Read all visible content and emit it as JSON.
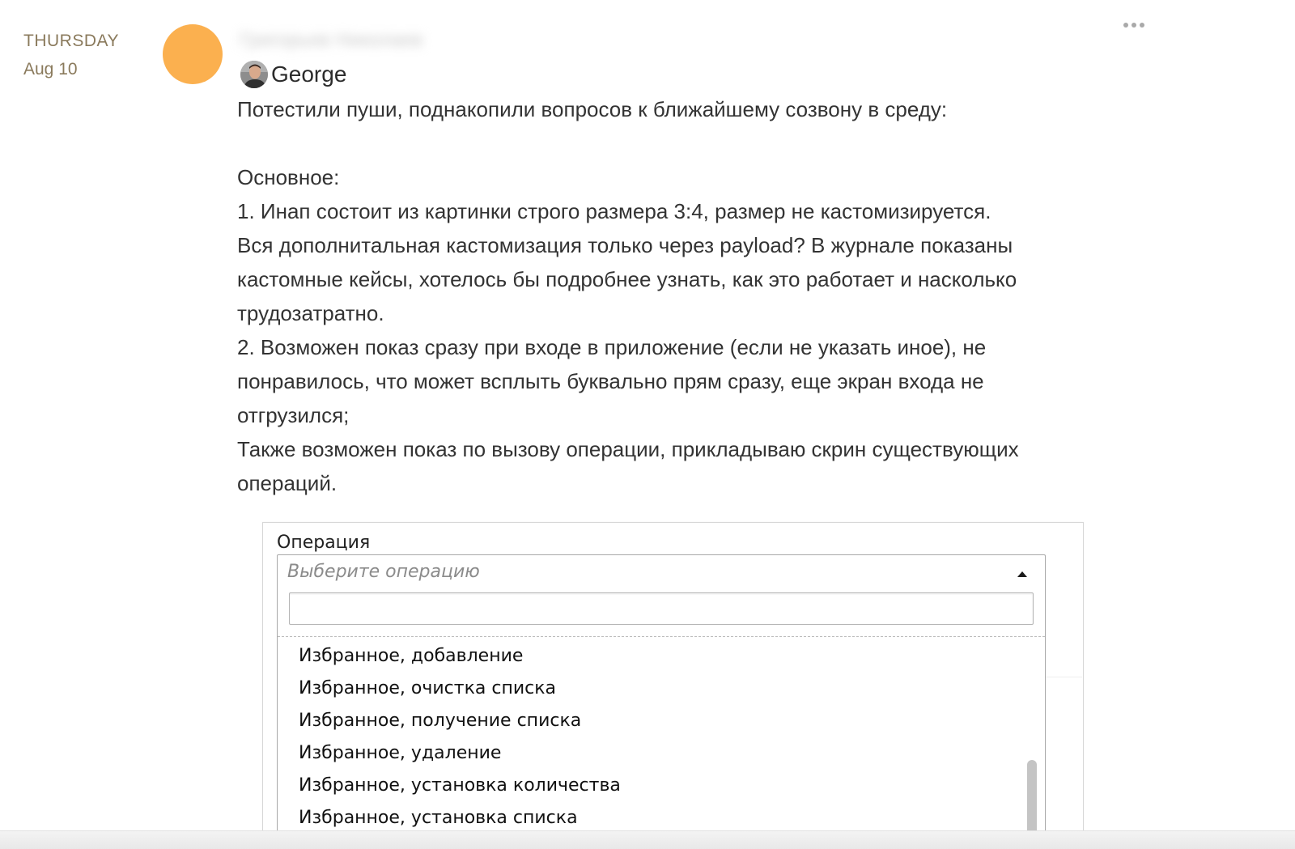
{
  "date": {
    "weekday": "THURSDAY",
    "date": "Aug 10"
  },
  "colors": {
    "avatar_bg": "#fbb04f",
    "date_text": "#8a7a5c"
  },
  "message": {
    "sender_blurred": "Григорьев Николаев",
    "author": "George",
    "author_avatar_icon": "user-photo-icon",
    "lines": [
      "Потестили пуши, поднакопили вопросов к ближайшему созвону в среду:",
      "",
      "Основное:",
      "1. Инап состоит из картинки строго размера 3:4, размер не кастомизируется.",
      "Вся дополнитальная кастомизация только через payload? В журнале показаны",
      "кастомные кейсы, хотелось бы подробнее узнать, как это работает и насколько",
      "трудозатратно.",
      "2. Возможен показ сразу при входе в приложение (если не указать иное), не",
      "понравилось, что может всплыть буквально прям сразу, еще экран входа не",
      "отгрузился;",
      "Также возможен показ по вызову операции, прикладываю скрин существующих",
      "операций."
    ]
  },
  "attachment": {
    "field_label": "Операция",
    "select_placeholder": "Выберите операцию",
    "search_value": "",
    "search_icon": "search-icon",
    "options": [
      "Избранное, добавление",
      "Избранное, очистка списка",
      "Избранное, получение списка",
      "Избранное, удаление",
      "Избранное, установка количества",
      "Избранное, установка списка"
    ]
  }
}
